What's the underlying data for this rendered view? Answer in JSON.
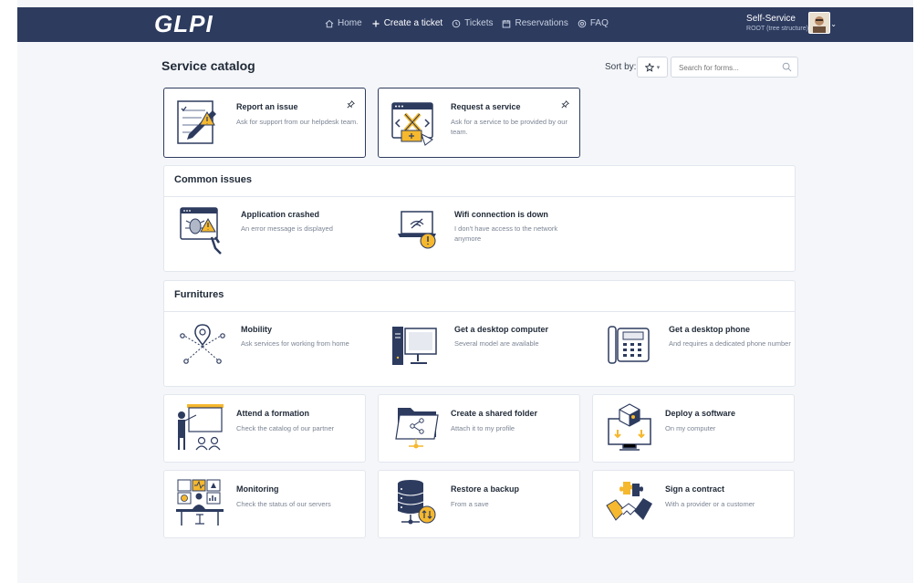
{
  "app": {
    "logo": "GLPI"
  },
  "nav": [
    {
      "label": "Home",
      "icon": "home-icon"
    },
    {
      "label": "Create a ticket",
      "icon": "plus-icon",
      "active": true
    },
    {
      "label": "Tickets",
      "icon": "clock-icon"
    },
    {
      "label": "Reservations",
      "icon": "calendar-icon"
    },
    {
      "label": "FAQ",
      "icon": "help-icon"
    }
  ],
  "user": {
    "name": "Self-Service",
    "role": "ROOT (tree structure)"
  },
  "page": {
    "title": "Service catalog",
    "sort_label": "Sort by:",
    "sort_icon": "star-icon",
    "search_placeholder": "Search for forms..."
  },
  "pinned": [
    {
      "title": "Report an issue",
      "desc": "Ask for support from our helpdesk team.",
      "icon": "report-issue-icon"
    },
    {
      "title": "Request a service",
      "desc": "Ask for a service to be provided by our team.",
      "icon": "request-service-icon"
    }
  ],
  "sections": [
    {
      "title": "Common issues",
      "items": [
        {
          "title": "Application crashed",
          "desc": "An error message is displayed",
          "icon": "app-crash-icon"
        },
        {
          "title": "Wifi connection is down",
          "desc": "I don't have access to the network anymore",
          "icon": "wifi-down-icon"
        }
      ]
    },
    {
      "title": "Furnitures",
      "items": [
        {
          "title": "Mobility",
          "desc": "Ask services for working from home",
          "icon": "mobility-icon"
        },
        {
          "title": "Get a desktop computer",
          "desc": "Several model are available",
          "icon": "desktop-computer-icon"
        },
        {
          "title": "Get a desktop phone",
          "desc": "And requires a dedicated phone number",
          "icon": "desktop-phone-icon"
        }
      ]
    }
  ],
  "cards": [
    {
      "title": "Attend a formation",
      "desc": "Check the catalog of our partner",
      "icon": "formation-icon"
    },
    {
      "title": "Create a shared folder",
      "desc": "Attach it to my profile",
      "icon": "shared-folder-icon"
    },
    {
      "title": "Deploy a software",
      "desc": "On my computer",
      "icon": "deploy-software-icon"
    },
    {
      "title": "Monitoring",
      "desc": "Check the status of our servers",
      "icon": "monitoring-icon"
    },
    {
      "title": "Restore a backup",
      "desc": "From a save",
      "icon": "restore-backup-icon"
    },
    {
      "title": "Sign a contract",
      "desc": "With a provider or a customer",
      "icon": "sign-contract-icon"
    }
  ],
  "colors": {
    "navbar": "#2d3b5f",
    "accent": "#f5b82e",
    "page_bg": "#f5f6f9"
  }
}
